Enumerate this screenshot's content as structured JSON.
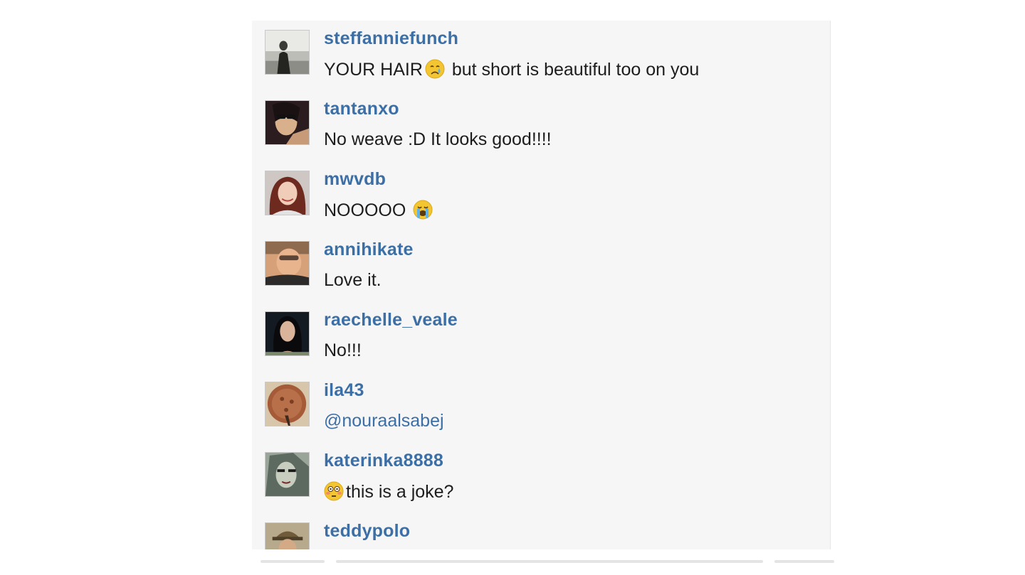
{
  "comments": [
    {
      "username": "steffanniefunch",
      "text_before": "YOUR HAIR",
      "emoji": "crying-face",
      "text_after": " but short is beautiful too on you",
      "avatar": "avatar-beach"
    },
    {
      "username": "tantanxo",
      "text_before": "No weave :D It looks good!!!!",
      "emoji": "",
      "text_after": "",
      "avatar": "avatar-sunglasses"
    },
    {
      "username": "mwvdb",
      "text_before": "NOOOOO ",
      "emoji": "loudly-crying-face",
      "text_after": "",
      "avatar": "avatar-redhair"
    },
    {
      "username": "annihikate",
      "text_before": "Love it.",
      "emoji": "",
      "text_after": "",
      "avatar": "avatar-selfie"
    },
    {
      "username": "raechelle_veale",
      "text_before": "No!!!",
      "emoji": "",
      "text_after": "",
      "avatar": "avatar-darkhair"
    },
    {
      "username": "ila43",
      "mention": "@nouraalsabej",
      "avatar": "avatar-round"
    },
    {
      "username": "katerinka8888",
      "text_before": "",
      "emoji": "flushed-face",
      "text_after": "this is a joke?",
      "avatar": "avatar-face"
    },
    {
      "username": "teddypolo",
      "text_before": "",
      "emoji": "",
      "text_after": "",
      "avatar": "avatar-hat"
    }
  ],
  "colors": {
    "username": "#3b6fa6",
    "text": "#1d1d1d",
    "panel_bg": "#f6f6f6"
  }
}
